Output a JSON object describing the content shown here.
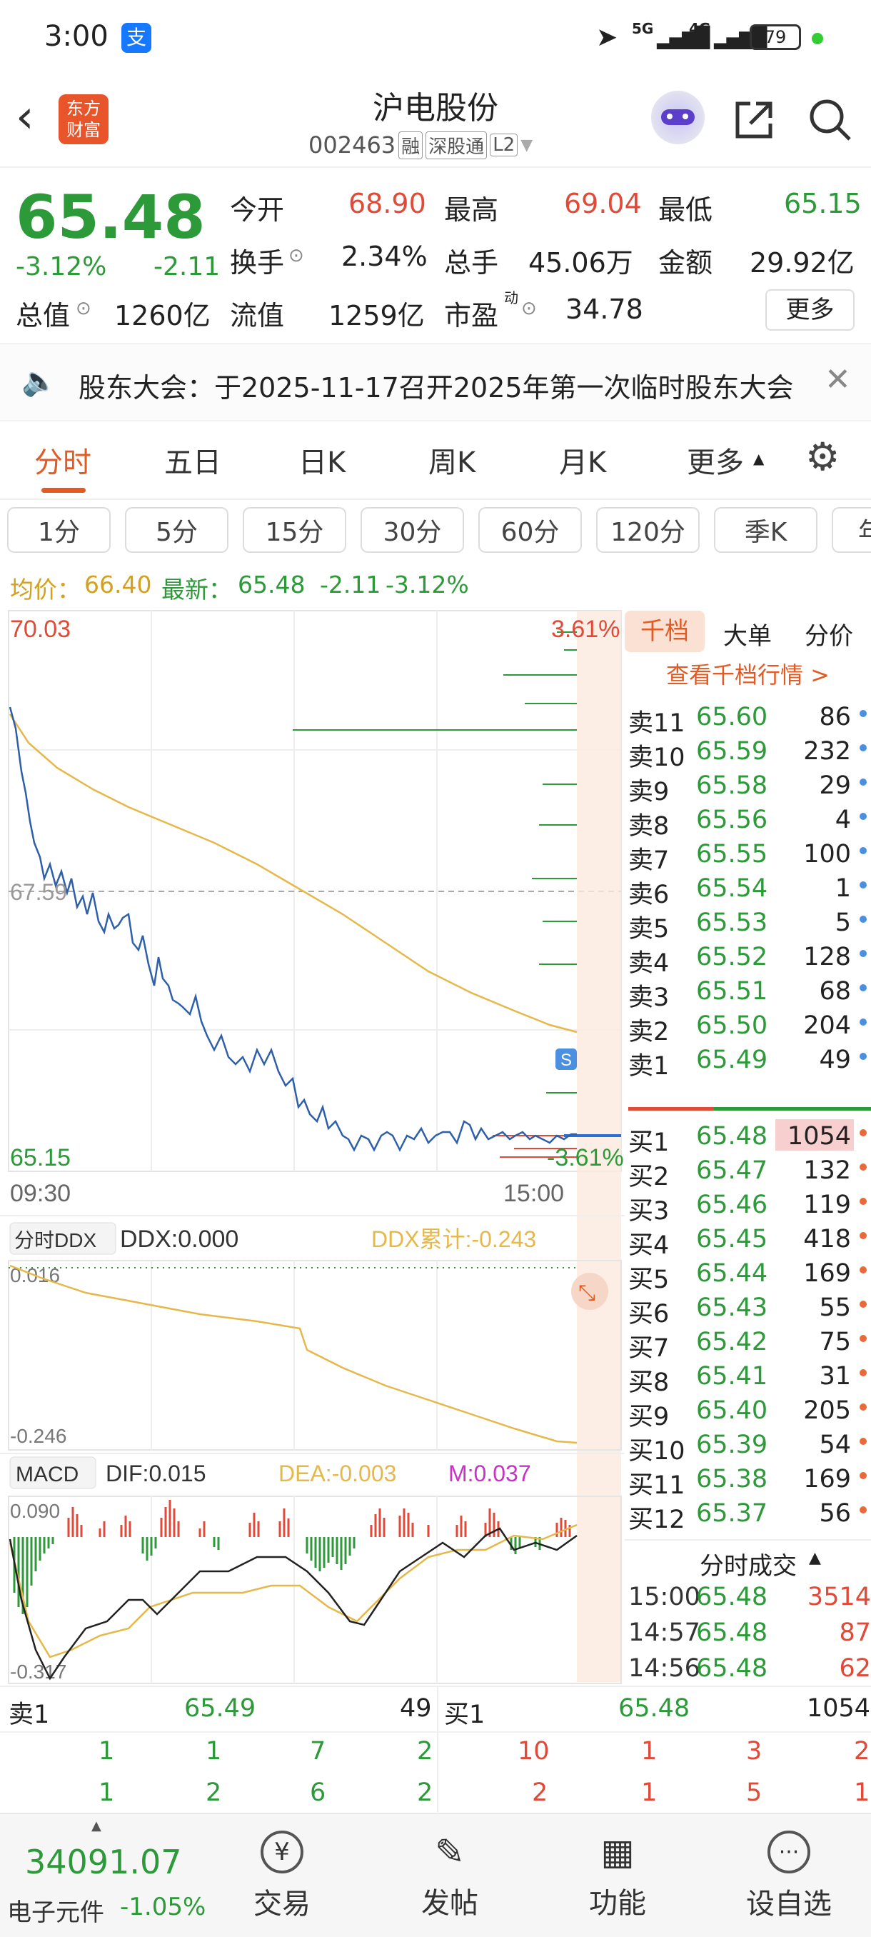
{
  "status": {
    "time": "3:00",
    "app_badge": "支",
    "net1": "5G",
    "net2": "4G",
    "battery": "79"
  },
  "header": {
    "logo_line1": "东方",
    "logo_line2": "财富",
    "name": "沪电股份",
    "code": "002463",
    "tags": [
      "融",
      "深股通",
      "L2"
    ]
  },
  "quote": {
    "price": "65.48",
    "pct": "-3.12%",
    "chg": "-2.11",
    "open_label": "今开",
    "open": "68.90",
    "high_label": "最高",
    "high": "69.04",
    "low_label": "最低",
    "low": "65.15",
    "turnover_label": "换手",
    "turnover": "2.34%",
    "vol_label": "总手",
    "vol": "45.06万",
    "amt_label": "金额",
    "amt": "29.92亿",
    "mcap_label": "总值",
    "mcap": "1260亿",
    "float_label": "流值",
    "float": "1259亿",
    "pe_label": "市盈",
    "pe_sup": "动",
    "pe": "34.78",
    "more": "更多"
  },
  "notice": {
    "text": "股东大会：于2025-11-17召开2025年第一次临时股东大会"
  },
  "tabs": [
    "分时",
    "五日",
    "日K",
    "周K",
    "月K",
    "更多"
  ],
  "periods": [
    "1分",
    "5分",
    "15分",
    "30分",
    "60分",
    "120分",
    "季K",
    "年"
  ],
  "avgline": {
    "avg_label": "均价：",
    "avg": "66.40",
    "last_label": "最新：",
    "last": "65.48",
    "chg": "-2.11",
    "pct": "-3.12%"
  },
  "chart": {
    "y_max": "70.03",
    "pct_max": "3.61%",
    "y_mid": "67.59",
    "y_min": "65.15",
    "pct_min": "-3.61%",
    "t_start": "09:30",
    "t_end": "15:00"
  },
  "ddx": {
    "selector": "分时DDX",
    "ddx": "DDX:0.000",
    "cum": "DDX累计:-0.243",
    "top": "0.016",
    "bottom": "-0.246"
  },
  "macd": {
    "selector": "MACD",
    "dif": "DIF:0.015",
    "dea": "DEA:-0.003",
    "m": "M:0.037",
    "top": "0.090",
    "bottom": "-0.317"
  },
  "orderbook": {
    "tabs": [
      "千档",
      "大单",
      "分价"
    ],
    "link": "查看千档行情 >",
    "asks": [
      {
        "l": "卖11",
        "p": "65.60",
        "v": "86"
      },
      {
        "l": "卖10",
        "p": "65.59",
        "v": "232"
      },
      {
        "l": "卖9",
        "p": "65.58",
        "v": "29"
      },
      {
        "l": "卖8",
        "p": "65.56",
        "v": "4"
      },
      {
        "l": "卖7",
        "p": "65.55",
        "v": "100"
      },
      {
        "l": "卖6",
        "p": "65.54",
        "v": "1"
      },
      {
        "l": "卖5",
        "p": "65.53",
        "v": "5"
      },
      {
        "l": "卖4",
        "p": "65.52",
        "v": "128"
      },
      {
        "l": "卖3",
        "p": "65.51",
        "v": "68"
      },
      {
        "l": "卖2",
        "p": "65.50",
        "v": "204"
      },
      {
        "l": "卖1",
        "p": "65.49",
        "v": "49"
      }
    ],
    "bids": [
      {
        "l": "买1",
        "p": "65.48",
        "v": "1054"
      },
      {
        "l": "买2",
        "p": "65.47",
        "v": "132"
      },
      {
        "l": "买3",
        "p": "65.46",
        "v": "119"
      },
      {
        "l": "买4",
        "p": "65.45",
        "v": "418"
      },
      {
        "l": "买5",
        "p": "65.44",
        "v": "169"
      },
      {
        "l": "买6",
        "p": "65.43",
        "v": "55"
      },
      {
        "l": "买7",
        "p": "65.42",
        "v": "75"
      },
      {
        "l": "买8",
        "p": "65.41",
        "v": "31"
      },
      {
        "l": "买9",
        "p": "65.40",
        "v": "205"
      },
      {
        "l": "买10",
        "p": "65.39",
        "v": "54"
      },
      {
        "l": "买11",
        "p": "65.38",
        "v": "169"
      },
      {
        "l": "买12",
        "p": "65.37",
        "v": "56"
      }
    ],
    "ticks_label": "分时成交",
    "ticks": [
      {
        "t": "15:00",
        "p": "65.48",
        "v": "3514"
      },
      {
        "t": "14:57",
        "p": "65.48",
        "v": "87"
      },
      {
        "t": "14:56",
        "p": "65.48",
        "v": "62"
      }
    ]
  },
  "bottom": {
    "sell_label": "卖1",
    "sell_price": "65.49",
    "sell_vol": "49",
    "buy_label": "买1",
    "buy_price": "65.48",
    "buy_vol": "1054",
    "sell_row1": [
      "1",
      "1",
      "7",
      "2"
    ],
    "sell_row2": [
      "1",
      "2",
      "6",
      "2"
    ],
    "buy_row1": [
      "10",
      "1",
      "3",
      "2"
    ],
    "buy_row2": [
      "2",
      "1",
      "5",
      "1"
    ]
  },
  "nav": {
    "index_value": "34091.07",
    "index_name": "电子元件",
    "index_pct": "-1.05%",
    "items": [
      "交易",
      "发帖",
      "功能",
      "设自选"
    ]
  }
}
